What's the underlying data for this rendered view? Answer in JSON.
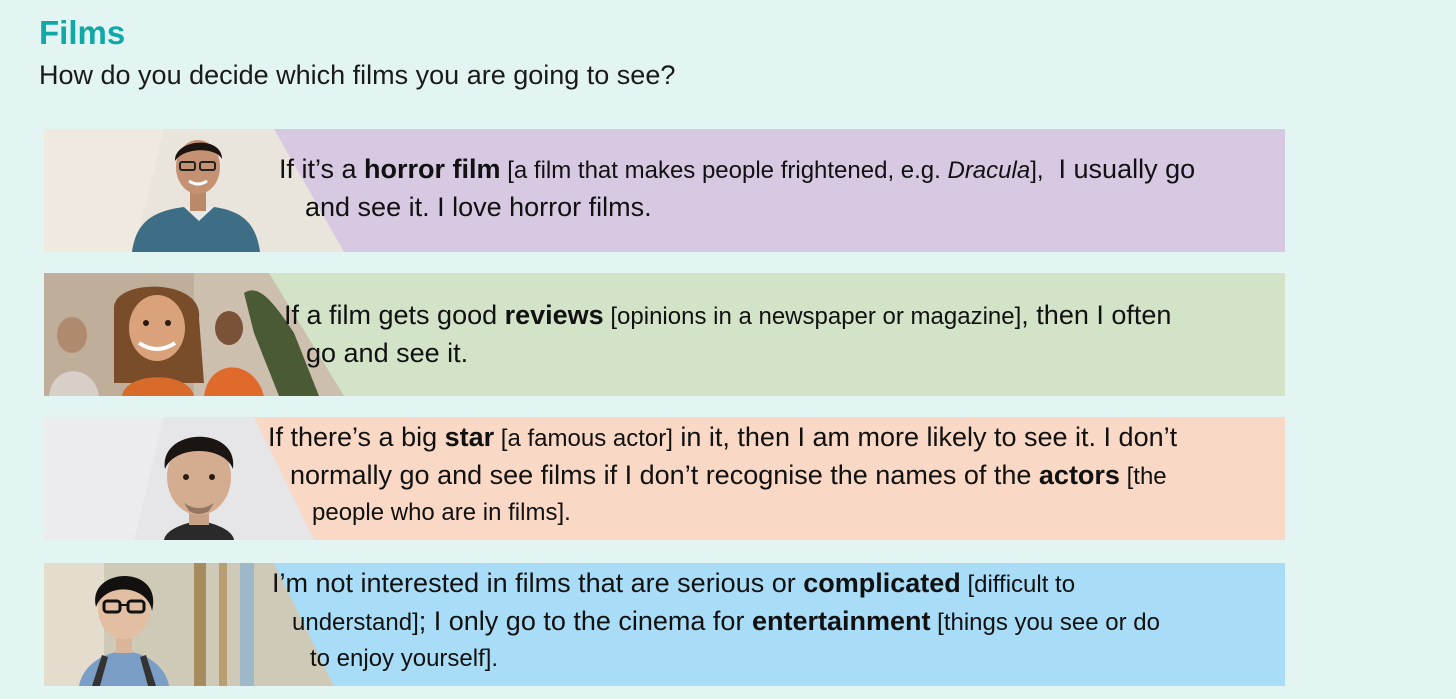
{
  "header": {
    "title": "Films",
    "subtitle": "How do you decide which films you are going to see?"
  },
  "cards": [
    {
      "color": "#d8c9e2",
      "photo": "young man with glasses and blue sweater",
      "line1": {
        "a": "If it’s a ",
        "b": "horror film",
        "g1": " [a film that makes people frightened, e.g. ",
        "gi": "Dracula",
        "g2": "],",
        "c": "  I usually go"
      },
      "line2": "and see it. I love horror films."
    },
    {
      "color": "#d3e3c8",
      "photo": "smiling young woman in a crowd",
      "line1": {
        "a": "If a film gets good ",
        "b": "reviews",
        "g": " [opinions in a newspaper or magazine]",
        "c": ", then I often"
      },
      "line2": "go and see it."
    },
    {
      "color": "#f9d8c5",
      "photo": "young man with dark hair",
      "line1": {
        "a": "If there’s a big ",
        "b": "star",
        "g": " [a famous actor]",
        "c": " in it, then I am more likely to see it. I don’t"
      },
      "line2": {
        "a": "normally go and see films if I don’t recognise the names of the ",
        "b": "actors",
        "g": " [the"
      },
      "line3": "people who are in films]."
    },
    {
      "color": "#a9dcf6",
      "photo": "young person with glasses and backpack",
      "line1": {
        "a": "I’m not interested in films that are serious or ",
        "b": "complicated",
        "g": " [difficult to"
      },
      "line2": {
        "g": "understand]",
        "a": "; I only go to the cinema for ",
        "b": "entertainment",
        "g2": " [things you see or do"
      },
      "line3": "to enjoy yourself]."
    }
  ]
}
